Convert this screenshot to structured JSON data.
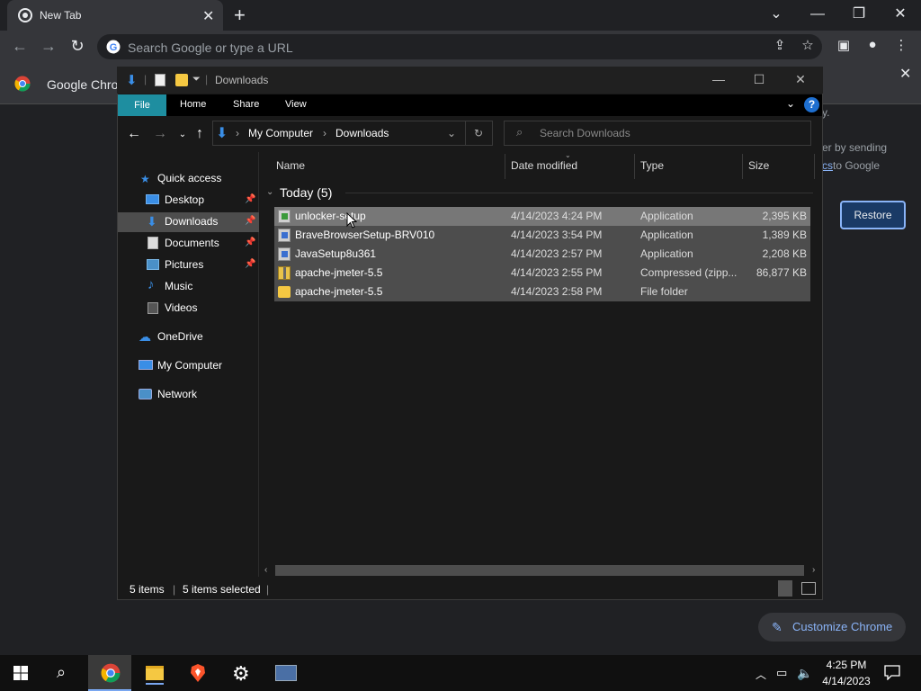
{
  "chrome": {
    "tab_title": "New Tab",
    "omnibox_placeholder": "Search Google or type a URL",
    "bookmark_text": "Google Chrom",
    "infobar_text1": "y.",
    "infobar_text2": "er by sending",
    "infobar_link": "cs",
    "infobar_text3": "to Google",
    "restore_label": "Restore",
    "customize_label": "Customize Chrome"
  },
  "explorer": {
    "title": "Downloads",
    "ribbon_tabs": [
      "File",
      "Home",
      "Share",
      "View"
    ],
    "breadcrumb": [
      "My Computer",
      "Downloads"
    ],
    "search_placeholder": "Search Downloads",
    "nav_items": [
      {
        "label": "Quick access",
        "icon": "star-icon"
      },
      {
        "label": "Desktop",
        "icon": "desktop-icon",
        "pinned": true
      },
      {
        "label": "Downloads",
        "icon": "download-icon",
        "pinned": true,
        "selected": true
      },
      {
        "label": "Documents",
        "icon": "documents-icon",
        "pinned": true
      },
      {
        "label": "Pictures",
        "icon": "pictures-icon",
        "pinned": true
      },
      {
        "label": "Music",
        "icon": "music-icon"
      },
      {
        "label": "Videos",
        "icon": "videos-icon"
      },
      {
        "label": "OneDrive",
        "icon": "cloud-icon"
      },
      {
        "label": "My Computer",
        "icon": "computer-icon"
      },
      {
        "label": "Network",
        "icon": "network-icon"
      }
    ],
    "columns": [
      "Name",
      "Date modified",
      "Type",
      "Size"
    ],
    "group_label": "Today (5)",
    "files": [
      {
        "name": "unlocker-setup",
        "date": "4/14/2023 4:24 PM",
        "type": "Application",
        "size": "2,395 KB",
        "icon": "installer-icon"
      },
      {
        "name": "BraveBrowserSetup-BRV010",
        "date": "4/14/2023 3:54 PM",
        "type": "Application",
        "size": "1,389 KB",
        "icon": "installer-icon"
      },
      {
        "name": "JavaSetup8u361",
        "date": "4/14/2023 2:57 PM",
        "type": "Application",
        "size": "2,208 KB",
        "icon": "installer-icon"
      },
      {
        "name": "apache-jmeter-5.5",
        "date": "4/14/2023 2:55 PM",
        "type": "Compressed (zipp...",
        "size": "86,877 KB",
        "icon": "zip-icon"
      },
      {
        "name": "apache-jmeter-5.5",
        "date": "4/14/2023 2:58 PM",
        "type": "File folder",
        "size": "",
        "icon": "folder-icon"
      }
    ],
    "status_items": "5 items",
    "status_selected": "5 items selected"
  },
  "taskbar": {
    "time": "4:25 PM",
    "date": "4/14/2023"
  }
}
